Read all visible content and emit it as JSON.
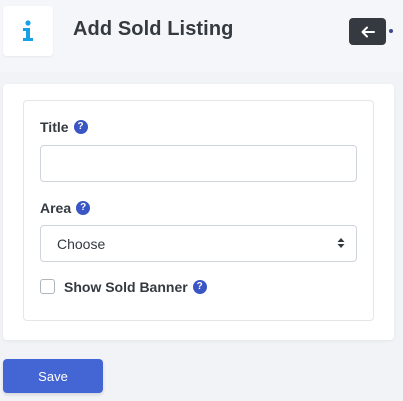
{
  "header": {
    "title": "Add Sold Listing",
    "info_icon": "info-icon",
    "back_icon": "arrow-left-icon"
  },
  "form": {
    "title_label": "Title",
    "title_value": "",
    "area_label": "Area",
    "area_selected": "Choose",
    "show_sold_banner_label": "Show Sold Banner",
    "show_sold_banner_checked": false,
    "help_icon": "question-circle-icon"
  },
  "actions": {
    "save_label": "Save"
  },
  "colors": {
    "accent": "#4466d4",
    "info_icon": "#17a2e8",
    "help_icon": "#3a55c4",
    "dark_button": "#343a40"
  }
}
